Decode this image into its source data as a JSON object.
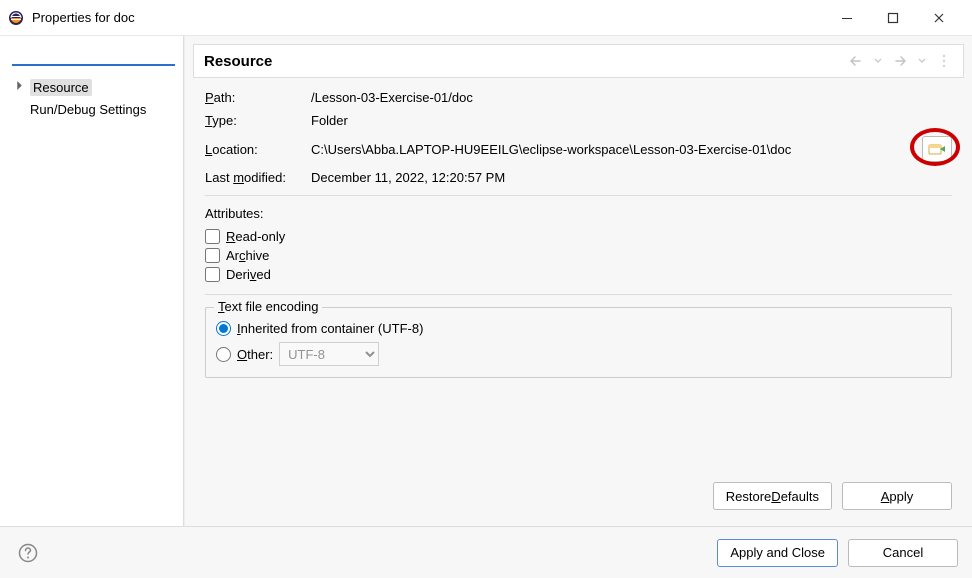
{
  "window": {
    "title": "Properties for doc"
  },
  "sidebar": {
    "filter_value": "",
    "items": [
      {
        "label": "Resource",
        "selected": true,
        "expandable": true
      },
      {
        "label": "Run/Debug Settings",
        "selected": false,
        "expandable": false
      }
    ]
  },
  "panel": {
    "heading": "Resource",
    "info": {
      "path_label": "Path:",
      "path_value": "/Lesson-03-Exercise-01/doc",
      "type_label": "Type:",
      "type_value": "Folder",
      "location_label": "Location:",
      "location_value": "C:\\Users\\Abba.LAPTOP-HU9EEILG\\eclipse-workspace\\Lesson-03-Exercise-01\\doc",
      "last_modified_label_prefix": "Last ",
      "last_modified_label_mnemonic": "m",
      "last_modified_label_suffix": "odified:",
      "last_modified_value": "December 11, 2022, 12:20:57 PM"
    },
    "attributes": {
      "title": "Attributes:",
      "read_only_prefix": "",
      "read_only_mnemonic": "R",
      "read_only_suffix": "ead-only",
      "archive_prefix": "Ar",
      "archive_mnemonic": "c",
      "archive_suffix": "hive",
      "derived_prefix": "Deri",
      "derived_mnemonic": "v",
      "derived_suffix": "ed"
    },
    "encoding": {
      "legend_mnemonic": "T",
      "legend_suffix": "ext file encoding",
      "inherited_mnemonic": "I",
      "inherited_suffix": "nherited from container (UTF-8)",
      "other_mnemonic": "O",
      "other_suffix": "ther:",
      "combo_value": "UTF-8"
    },
    "buttons": {
      "restore_defaults_prefix": "Restore ",
      "restore_defaults_mnemonic": "D",
      "restore_defaults_suffix": "efaults",
      "apply_mnemonic": "A",
      "apply_suffix": "pply"
    }
  },
  "footer": {
    "apply_and_close": "Apply and Close",
    "cancel": "Cancel"
  }
}
